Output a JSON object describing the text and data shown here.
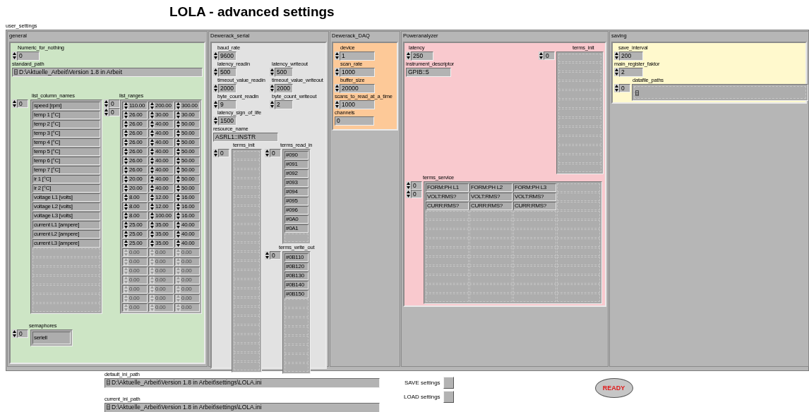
{
  "title": "LOLA - advanced settings",
  "cluster_label": "user_settings",
  "general": {
    "label": "general",
    "numeric_for_nothing": {
      "label": "Numeric_for_nothing",
      "value": "0"
    },
    "standard_path": {
      "label": "standard_path",
      "value": "D:\\Aktuelle_Arbeit\\Version 1.8 in Arbeit"
    },
    "list_column_names": {
      "label": "list_column_names",
      "index": "0",
      "items": [
        "speed [rpm]",
        "temp 1 [°C]",
        "temp 2 [°C]",
        "temp 3 [°C]",
        "temp 4 [°C]",
        "temp 5 [°C]",
        "temp 6 [°C]",
        "temp 7 [°C]",
        "ir 1 [°C]",
        "ir 2 [°C]",
        "voltage L1 [volts]",
        "voltage L2 [volts]",
        "voltage L3 [volts]",
        "current L1 [ampere]",
        "current L2 [ampere]",
        "current L3 [ampere]"
      ]
    },
    "list_ranges": {
      "label": "list_ranges",
      "indices": [
        "0",
        "0"
      ],
      "rows": [
        {
          "values": [
            "110.00",
            "200.00",
            "300.00"
          ],
          "disabled": false
        },
        {
          "values": [
            "26.00",
            "30.00",
            "30.00"
          ],
          "disabled": false
        },
        {
          "values": [
            "26.00",
            "40.00",
            "50.00"
          ],
          "disabled": false
        },
        {
          "values": [
            "26.00",
            "40.00",
            "50.00"
          ],
          "disabled": false
        },
        {
          "values": [
            "26.00",
            "40.00",
            "50.00"
          ],
          "disabled": false
        },
        {
          "values": [
            "26.00",
            "40.00",
            "50.00"
          ],
          "disabled": false
        },
        {
          "values": [
            "26.00",
            "40.00",
            "50.00"
          ],
          "disabled": false
        },
        {
          "values": [
            "26.00",
            "40.00",
            "50.00"
          ],
          "disabled": false
        },
        {
          "values": [
            "20.00",
            "40.00",
            "50.00"
          ],
          "disabled": false
        },
        {
          "values": [
            "20.00",
            "40.00",
            "50.00"
          ],
          "disabled": false
        },
        {
          "values": [
            "8.00",
            "12.00",
            "16.00"
          ],
          "disabled": false
        },
        {
          "values": [
            "8.00",
            "12.00",
            "16.00"
          ],
          "disabled": false
        },
        {
          "values": [
            "8.00",
            "100.00",
            "16.00"
          ],
          "disabled": false
        },
        {
          "values": [
            "25.00",
            "35.00",
            "40.00"
          ],
          "disabled": false
        },
        {
          "values": [
            "25.00",
            "35.00",
            "40.00"
          ],
          "disabled": false
        },
        {
          "values": [
            "25.00",
            "35.00",
            "40.00"
          ],
          "disabled": false
        },
        {
          "values": [
            "0.00",
            "0.00",
            "0.00"
          ],
          "disabled": true
        },
        {
          "values": [
            "0.00",
            "0.00",
            "0.00"
          ],
          "disabled": true
        },
        {
          "values": [
            "0.00",
            "0.00",
            "0.00"
          ],
          "disabled": true
        },
        {
          "values": [
            "0.00",
            "0.00",
            "0.00"
          ],
          "disabled": true
        },
        {
          "values": [
            "0.00",
            "0.00",
            "0.00"
          ],
          "disabled": true
        },
        {
          "values": [
            "0.00",
            "0.00",
            "0.00"
          ],
          "disabled": true
        },
        {
          "values": [
            "0.00",
            "0.00",
            "0.00"
          ],
          "disabled": true
        }
      ]
    },
    "semaphores": {
      "label": "semaphores",
      "index": "0",
      "items": [
        "seriell"
      ]
    }
  },
  "dewerack_serial": {
    "label": "Dewerack_serial",
    "rows": [
      [
        {
          "label": "baud_rate",
          "value": "9600"
        }
      ],
      [
        {
          "label": "latency_readin",
          "value": "500"
        },
        {
          "label": "latency_writeout",
          "value": "500"
        }
      ],
      [
        {
          "label": "timeout_value_readin",
          "value": "2000"
        },
        {
          "label": "timeout_value_writeout",
          "value": "2000"
        }
      ],
      [
        {
          "label": "byte_count_readin",
          "value": "9"
        },
        {
          "label": "byte_count_writeout",
          "value": "2"
        }
      ],
      [
        {
          "label": "latency_sign_of_life",
          "value": "1500"
        }
      ]
    ],
    "resource_name": {
      "label": "resource_name",
      "value": "ASRL1::INSTR"
    },
    "terms_init": {
      "label": "terms_init",
      "index": "0"
    },
    "terms_read_in": {
      "label": "terms_read_in",
      "index": "0",
      "items": [
        "#090",
        "#091",
        "#092",
        "#093",
        "#094",
        "#095",
        "#096",
        "#0A0",
        "#0A1"
      ]
    },
    "terms_write_out": {
      "label": "terms_write_out",
      "index": "0",
      "items": [
        "#0B110",
        "#0B120",
        "#0B130",
        "#0B140",
        "#0B150"
      ]
    }
  },
  "dewerack_daq": {
    "label": "Dewerack_DAQ",
    "controls": [
      {
        "label": "device",
        "value": "1"
      },
      {
        "label": "scan_rate",
        "value": "1000"
      },
      {
        "label": "buffer_size",
        "value": "20000"
      },
      {
        "label": "scans_to_read_at_a_time",
        "value": "1000"
      }
    ],
    "channels": {
      "label": "channels",
      "value": "0"
    }
  },
  "poweranalyzer": {
    "label": "Poweranalyzer",
    "latency": {
      "label": "latency",
      "value": "250"
    },
    "instrument_descriptor": {
      "label": "instrument_descriptor",
      "value": "GPIB::5"
    },
    "terms_init": {
      "label": "terms_init",
      "index": "0"
    },
    "terms_service": {
      "label": "terms_service",
      "indices": [
        "0",
        "0"
      ],
      "rows": [
        [
          "FORM:PH L1",
          "FORM:PH L2",
          "FORM:PH L3"
        ],
        [
          "VOLT:RMS?",
          "VOLT:RMS?",
          "VOLT:RMS?"
        ],
        [
          "CURR:RMS?",
          "CURR:RMS?",
          "CURR:RMS?"
        ]
      ]
    }
  },
  "saving": {
    "label": "saving",
    "save_interval": {
      "label": "save_interval",
      "value": "200"
    },
    "main_register_faktor": {
      "label": "main_register_faktor",
      "value": "2"
    },
    "datafile_paths": {
      "label": "datafile_paths",
      "index": "0"
    }
  },
  "default_ini_path": {
    "label": "default_ini_path",
    "value": "D:\\Aktuelle_Arbeit\\Version 1.8 in Arbeit\\settings\\LOLA.ini"
  },
  "current_ini_path": {
    "label": "current_ini_path",
    "value": "D:\\Aktuelle_Arbeit\\Version 1.8 in Arbeit\\settings\\LOLA.ini"
  },
  "buttons": [
    {
      "label": "SAVE settings"
    },
    {
      "label": "LOAD settings"
    }
  ],
  "status": {
    "label": "READY"
  }
}
